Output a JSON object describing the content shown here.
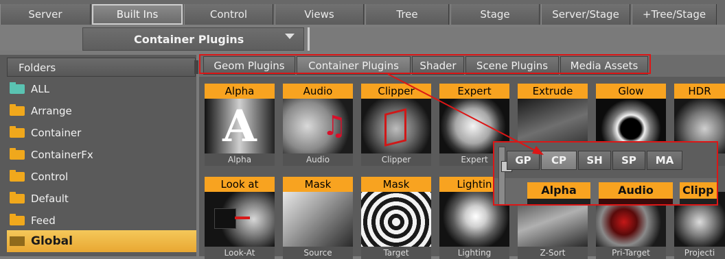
{
  "top_tabs": [
    "Server",
    "Built Ins",
    "Control",
    "Views",
    "Tree",
    "Stage",
    "Server/Stage",
    "+Tree/Stage"
  ],
  "dropdown": {
    "label": "Container Plugins"
  },
  "folders": {
    "header": "Folders",
    "items": [
      "ALL",
      "Arrange",
      "Container",
      "ContainerFx",
      "Control",
      "Default",
      "Feed",
      "Global"
    ],
    "selected": "Global"
  },
  "plugin_tabs": [
    "Geom Plugins",
    "Container Plugins",
    "Shader",
    "Scene Plugins",
    "Media Assets"
  ],
  "active_plugin_tab": "Container Plugins",
  "plugins_row1": [
    {
      "title": "Alpha",
      "caption": "Alpha"
    },
    {
      "title": "Audio",
      "caption": "Audio"
    },
    {
      "title": "Clipper",
      "caption": "Clipper"
    },
    {
      "title": "Expert",
      "caption": "Expert"
    },
    {
      "title": "Extrude",
      "caption": ""
    },
    {
      "title": "Glow",
      "caption": ""
    },
    {
      "title": "HDR",
      "caption": ""
    }
  ],
  "plugins_row2": [
    {
      "title": "Look at",
      "caption": "Look-At"
    },
    {
      "title": "Mask",
      "caption": "Source"
    },
    {
      "title": "Mask",
      "caption": "Target"
    },
    {
      "title": "Lightin",
      "caption": "Lighting"
    },
    {
      "title": "",
      "caption": "Z-Sort"
    },
    {
      "title": "",
      "caption": "Pri-Target"
    },
    {
      "title": "",
      "caption": "Projecti"
    }
  ],
  "inset": {
    "tabs": [
      "GP",
      "CP",
      "SH",
      "SP",
      "MA"
    ],
    "active": "CP",
    "titles": [
      "Alpha",
      "Audio",
      "Clipp"
    ]
  },
  "colors": {
    "accent": "#f8a320",
    "highlight": "#dc1616",
    "selected_folder": "#f4c85a"
  }
}
